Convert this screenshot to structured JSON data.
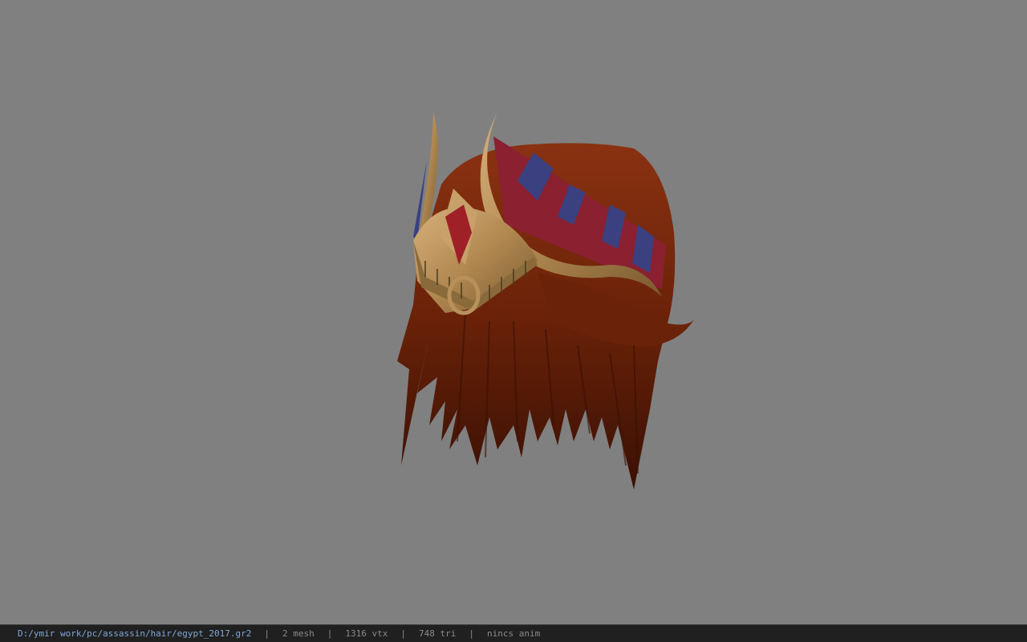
{
  "viewport": {
    "background_color": "#808080",
    "model_name": "hair-model"
  },
  "status_bar": {
    "file_path": "D:/ymir work/pc/assassin/hair/egypt_2017.gr2",
    "mesh_count": "2 mesh",
    "vertex_count": "1316 vtx",
    "triangle_count": "748 tri",
    "animation": "nincs anim"
  },
  "colors": {
    "hair_dark": "#4a1606",
    "hair_mid": "#7a2a0e",
    "gold": "#b8915a",
    "band_red": "#8a2030",
    "band_blue": "#3a4080",
    "gem_red": "#a02028"
  }
}
